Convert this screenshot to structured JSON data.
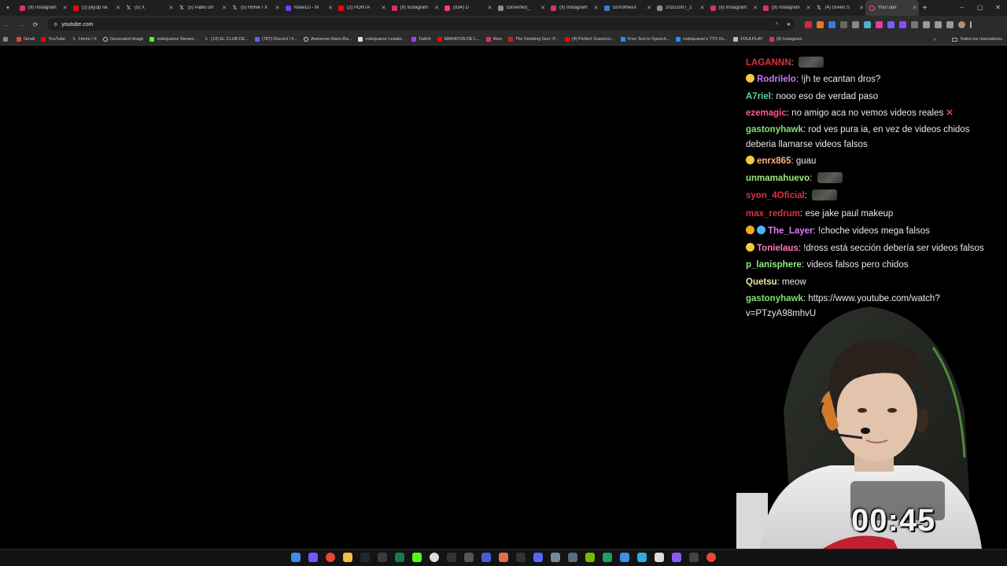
{
  "browser": {
    "tabs": [
      {
        "title": "(9) Instagram",
        "icon": "instagram-icon",
        "color": "#d6307a"
      },
      {
        "title": "(2) july3p na",
        "icon": "youtube-icon",
        "color": "#ff0000"
      },
      {
        "title": "(5) X",
        "icon": "x-icon",
        "color": "#111111"
      },
      {
        "title": "(5) Pablo on",
        "icon": "x-icon",
        "color": "#111111"
      },
      {
        "title": "(5) Home / X",
        "icon": "x-icon",
        "color": "#111111"
      },
      {
        "title": "RaveDJ - M",
        "icon": "ravedj-icon",
        "color": "#7a3cff"
      },
      {
        "title": "(2) PORTA",
        "icon": "youtube-icon",
        "color": "#ff0000"
      },
      {
        "title": "(9) Instagram",
        "icon": "instagram-icon",
        "color": "#d6307a"
      },
      {
        "title": "(834) D",
        "icon": "discord-icon",
        "color": "#ff3d6e"
      },
      {
        "title": "converted_",
        "icon": "globe-icon",
        "color": "#8a8a8a"
      },
      {
        "title": "(9) Instagram",
        "icon": "instagram-icon",
        "color": "#d6307a"
      },
      {
        "title": "G0X9mexX",
        "icon": "image-icon",
        "color": "#3a7bd5"
      },
      {
        "title": "20251007_2",
        "icon": "globe-icon",
        "color": "#8a8a8a"
      },
      {
        "title": "(9) Instagram",
        "icon": "instagram-icon",
        "color": "#d6307a"
      },
      {
        "title": "(9) Instagram",
        "icon": "instagram-icon",
        "color": "#d6307a"
      },
      {
        "title": "(4) Green S",
        "icon": "x-icon",
        "color": "#111111"
      },
      {
        "title": "YouTube",
        "icon": "loading-icon",
        "color": "#ff4d6d",
        "active": true
      }
    ],
    "address": "youtube.com",
    "bookmarks": [
      {
        "label": "Gmail",
        "icon": "gmail-icon",
        "color": "#ea4335"
      },
      {
        "label": "YouTube",
        "icon": "youtube-icon",
        "color": "#ff0000"
      },
      {
        "label": "Home / X",
        "icon": "x-icon",
        "color": "#222222"
      },
      {
        "label": "Generated image",
        "icon": "openai-icon",
        "color": "#cccccc"
      },
      {
        "label": "rodsquaree Stream...",
        "icon": "kick-icon",
        "color": "#53fc18"
      },
      {
        "label": "(13) EL CLUB DE...",
        "icon": "x-icon",
        "color": "#222222"
      },
      {
        "label": "(787) Discord | #...",
        "icon": "discord-icon",
        "color": "#5865f2"
      },
      {
        "label": "Awesome-Nano-Ba...",
        "icon": "github-icon",
        "color": "#dddddd"
      },
      {
        "label": "rodsquaree Leader...",
        "icon": "diamond-icon",
        "color": "#dddddd"
      },
      {
        "label": "Twitch",
        "icon": "twitch-icon",
        "color": "#9146ff"
      },
      {
        "label": "MARATON DE L...",
        "icon": "youtube-icon",
        "color": "#ff0000"
      },
      {
        "label": "likes",
        "icon": "instagram-icon",
        "color": "#d6307a"
      },
      {
        "label": "The Smoking Gun: P...",
        "icon": "gun-icon",
        "color": "#cc2222"
      },
      {
        "label": "(4) Perfect Scarecro...",
        "icon": "youtube-icon",
        "color": "#ff0000"
      },
      {
        "label": "Free Text to Speech...",
        "icon": "tts-icon",
        "color": "#2a8cff"
      },
      {
        "label": "rodsquaree's TTS Vo...",
        "icon": "tts-icon",
        "color": "#2a8cff"
      },
      {
        "label": "FOULPLAY",
        "icon": "foulplay-icon",
        "color": "#bbbbbb"
      },
      {
        "label": "(9) Instagram",
        "icon": "instagram-icon",
        "color": "#d6307a"
      }
    ],
    "all_bookmarks": "Todos los marcadores"
  },
  "chat": {
    "messages": [
      {
        "user": "LAGANNN",
        "color": "#e0303a",
        "text": "",
        "emote": true
      },
      {
        "user": "Rodrilelo",
        "color": "#c779ff",
        "text": "!jh te ecantan dros?",
        "badge": "#f5c842"
      },
      {
        "user": "A7riel",
        "color": "#5fd3a0",
        "text": "nooo eso de verdad paso"
      },
      {
        "user": "ezemagic",
        "color": "#ff5a8a",
        "text": "no amigo aca no vemos videos reales",
        "redx": "✕"
      },
      {
        "user": "gastonyhawk",
        "color": "#7ee36e",
        "text": "rod ves pura ia, en vez de videos chidos deberia llamarse videos falsos"
      },
      {
        "user": "enrx865",
        "color": "#ffb37a",
        "text": "guau",
        "badge": "#f5c842"
      },
      {
        "user": "unmamahuevo",
        "color": "#9ae87e",
        "text": "",
        "emote": true
      },
      {
        "user": "syon_4Oficial",
        "color": "#e0303a",
        "text": "",
        "emote": true
      },
      {
        "user": "max_redrum",
        "color": "#e0303a",
        "text": "ese jake paul makeup"
      },
      {
        "user": "The_Layer",
        "color": "#e07bff",
        "text": "!choche videos mega falsos",
        "badge": "#f5a623",
        "badge2": "#4fb3ff"
      },
      {
        "user": "Tonielaus",
        "color": "#ff7ab6",
        "text": "!dross está sección debería ser videos falsos",
        "badge": "#f5c842"
      },
      {
        "user": "p_lanisphere",
        "color": "#8df07a",
        "text": "videos falsos pero chidos"
      },
      {
        "user": "Quetsu",
        "color": "#f0e3a0",
        "text": "meow"
      },
      {
        "user": "gastonyhawk",
        "color": "#7ee36e",
        "text": "https://www.youtube.com/watch?v=PTzyA98mhvU"
      }
    ]
  },
  "overlay": {
    "timer": "00:45"
  },
  "taskbar": {
    "icons": [
      {
        "name": "windows-start-icon",
        "color": "#3b8eea"
      },
      {
        "name": "copilot-icon",
        "color": "#6b5bff"
      },
      {
        "name": "chrome-icon",
        "color": "#e8453c"
      },
      {
        "name": "file-explorer-icon",
        "color": "#f0c040"
      },
      {
        "name": "steam-icon",
        "color": "#1b2838"
      },
      {
        "name": "obs-icon",
        "color": "#3a3a3a"
      },
      {
        "name": "excel-icon",
        "color": "#1d7a44"
      },
      {
        "name": "kick-icon",
        "color": "#53fc18"
      },
      {
        "name": "app-circle-icon",
        "color": "#dddddd"
      },
      {
        "name": "media-player-icon",
        "color": "#333333"
      },
      {
        "name": "settings-icon",
        "color": "#555555"
      },
      {
        "name": "vegas-icon",
        "color": "#4b5bd6"
      },
      {
        "name": "photos-icon",
        "color": "#e0704a"
      },
      {
        "name": "notes-icon",
        "color": "#333333"
      },
      {
        "name": "discord-icon",
        "color": "#5865f2"
      },
      {
        "name": "vpn-icon",
        "color": "#778899"
      },
      {
        "name": "mail-icon",
        "color": "#5a6c80"
      },
      {
        "name": "nvidia-icon",
        "color": "#76b900"
      },
      {
        "name": "shield-icon",
        "color": "#20a060"
      },
      {
        "name": "store-icon",
        "color": "#3b8eea"
      },
      {
        "name": "maps-icon",
        "color": "#30a9de"
      },
      {
        "name": "calendar-icon",
        "color": "#dddddd"
      },
      {
        "name": "obsidian-icon",
        "color": "#8a5cf5"
      },
      {
        "name": "terminal-icon",
        "color": "#444444"
      },
      {
        "name": "chrome-alt-icon",
        "color": "#e8453c"
      }
    ]
  }
}
